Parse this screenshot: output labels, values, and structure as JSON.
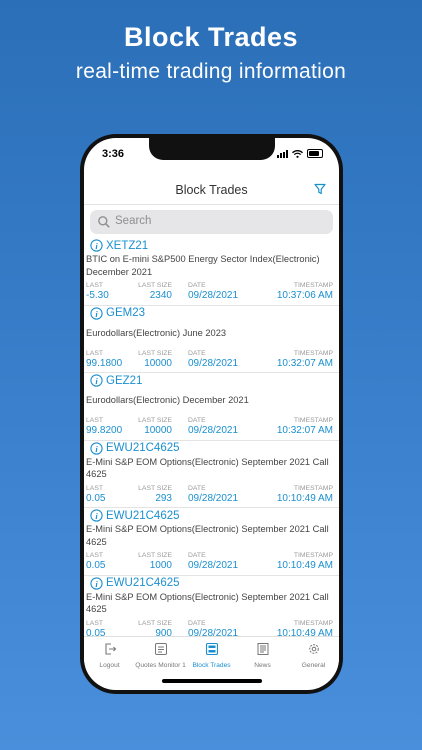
{
  "promo": {
    "title": "Block Trades",
    "subtitle": "real-time trading information"
  },
  "status": {
    "time": "3:36"
  },
  "nav": {
    "title": "Block Trades"
  },
  "search": {
    "placeholder": "Search"
  },
  "labels": {
    "last": "LAST",
    "last_size": "LAST SIZE",
    "date": "DATE",
    "timestamp": "TIMESTAMP"
  },
  "trades": [
    {
      "symbol": "XETZ21",
      "desc": "BTIC on E-mini S&P500 Energy Sector Index(Electronic) December 2021",
      "last": "-5.30",
      "size": "2340",
      "date": "09/28/2021",
      "time": "10:37:06 AM"
    },
    {
      "symbol": "GEM23",
      "desc": "Eurodollars(Electronic) June 2023",
      "last": "99.1800",
      "size": "10000",
      "date": "09/28/2021",
      "time": "10:32:07 AM"
    },
    {
      "symbol": "GEZ21",
      "desc": "Eurodollars(Electronic) December 2021",
      "last": "99.8200",
      "size": "10000",
      "date": "09/28/2021",
      "time": "10:32:07 AM"
    },
    {
      "symbol": "EWU21C4625",
      "desc": "E-Mini S&P EOM Options(Electronic) September 2021 Call 4625",
      "last": "0.05",
      "size": "293",
      "date": "09/28/2021",
      "time": "10:10:49 AM"
    },
    {
      "symbol": "EWU21C4625",
      "desc": "E-Mini S&P EOM Options(Electronic) September 2021 Call 4625",
      "last": "0.05",
      "size": "1000",
      "date": "09/28/2021",
      "time": "10:10:49 AM"
    },
    {
      "symbol": "EWU21C4625",
      "desc": "E-Mini S&P EOM Options(Electronic) September 2021 Call 4625",
      "last": "0.05",
      "size": "900",
      "date": "09/28/2021",
      "time": "10:10:49 AM"
    }
  ],
  "tabs": [
    {
      "label": "Logout",
      "icon": "logout-icon"
    },
    {
      "label": "Quotes Monitor 1",
      "icon": "quotes-monitor-icon"
    },
    {
      "label": "Block Trades",
      "icon": "block-trades-icon",
      "active": true
    },
    {
      "label": "News",
      "icon": "news-icon"
    },
    {
      "label": "General",
      "icon": "gear-icon"
    }
  ],
  "colors": {
    "accent": "#1a8fd0",
    "background_top": "#2b6fb8",
    "background_bottom": "#4a8fdb"
  }
}
